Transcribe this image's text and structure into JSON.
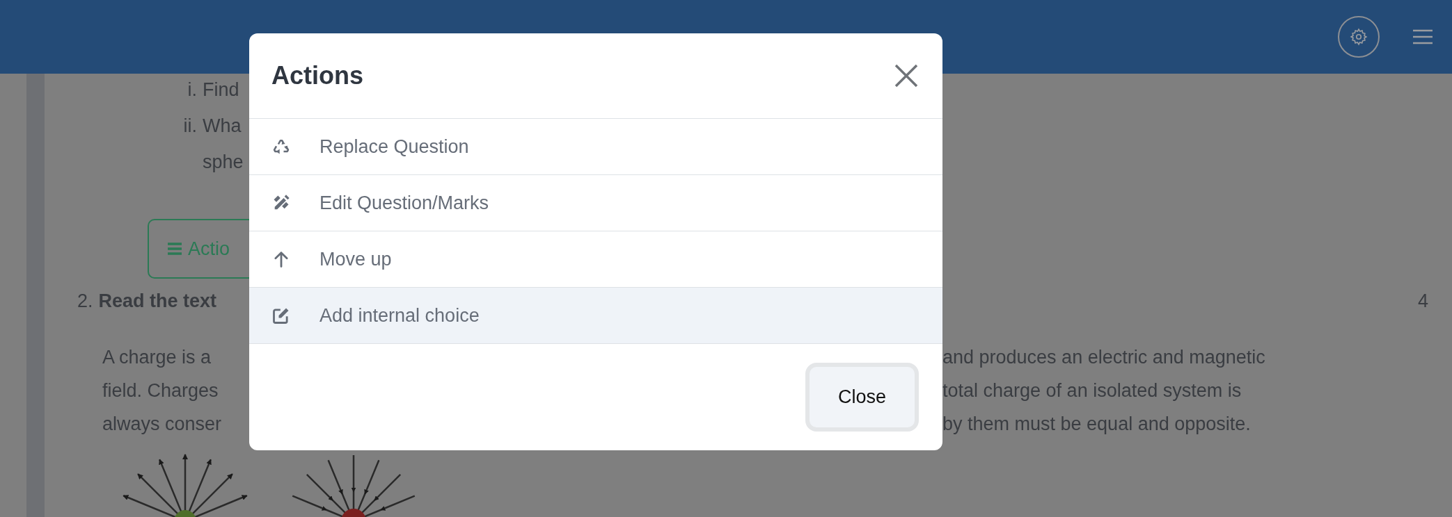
{
  "background": {
    "sub_questions": [
      {
        "marker": "i.",
        "lines": [
          "Find"
        ]
      },
      {
        "marker": "ii.",
        "lines": [
          "Wha",
          "sphe"
        ]
      }
    ],
    "actions_button": {
      "label": "Actio"
    },
    "question": {
      "number": "2.",
      "title": "Read the text",
      "marks": "4",
      "paragraph_lines": [
        {
          "left": "A charge is a",
          "right": "and produces an electric and magnetic"
        },
        {
          "left": "field. Charges",
          "right": "total charge of an isolated system is"
        },
        {
          "left": "always conser",
          "right": "by them must be equal and opposite."
        }
      ]
    }
  },
  "modal": {
    "title": "Actions",
    "items": [
      {
        "kind": "replace",
        "label": "Replace Question",
        "highlighted": false
      },
      {
        "kind": "edit",
        "label": "Edit Question/Marks",
        "highlighted": false
      },
      {
        "kind": "move",
        "label": "Move up",
        "highlighted": false
      },
      {
        "kind": "choice",
        "label": "Add internal choice",
        "highlighted": true
      }
    ],
    "close_button": "Close"
  }
}
